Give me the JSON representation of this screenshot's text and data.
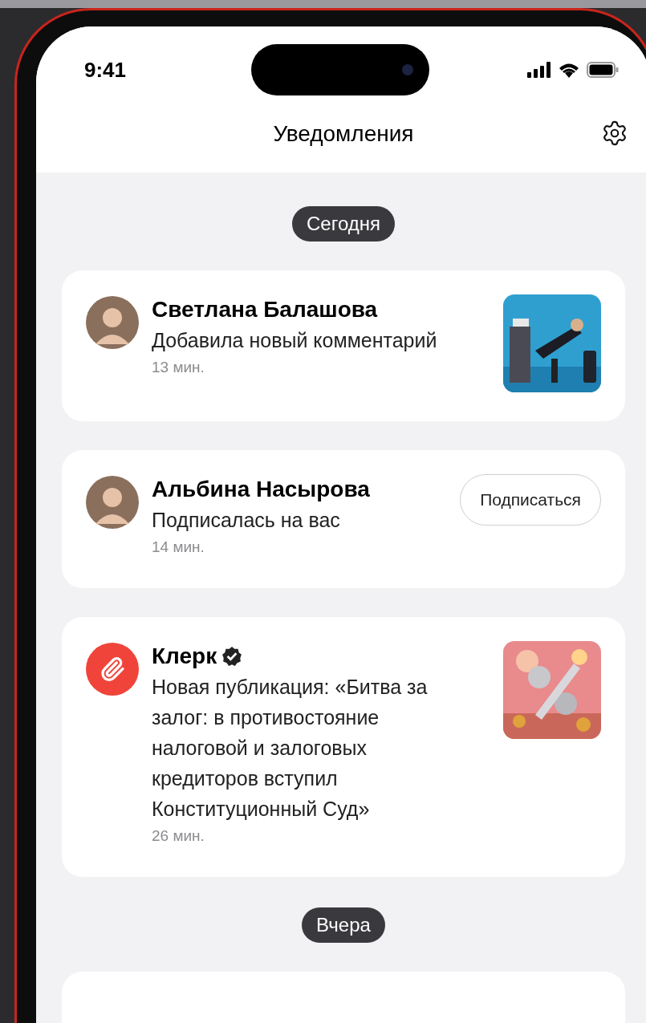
{
  "status_bar": {
    "time": "9:41"
  },
  "header": {
    "title": "Уведомления"
  },
  "sections": [
    {
      "label": "Сегодня",
      "items": [
        {
          "avatar": {
            "kind": "person"
          },
          "name": "Светлана Балашова",
          "verified": false,
          "text": "Добавила новый комментарий",
          "time": "13 мин."
        },
        {
          "avatar": {
            "kind": "person"
          },
          "name": "Альбина Насырова",
          "verified": false,
          "text": "Подписалась на вас",
          "time": "14 мин.",
          "action": {
            "kind": "button",
            "label": "Подписаться"
          }
        },
        {
          "avatar": {
            "kind": "logo"
          },
          "name": "Клерк",
          "verified": true,
          "text": "Новая публикация: «Битва за залог: в противостояние налоговой и залоговых кредиторов вступил Конституционный Суд»",
          "time": "26 мин."
        }
      ]
    },
    {
      "label": "Вчера"
    }
  ]
}
